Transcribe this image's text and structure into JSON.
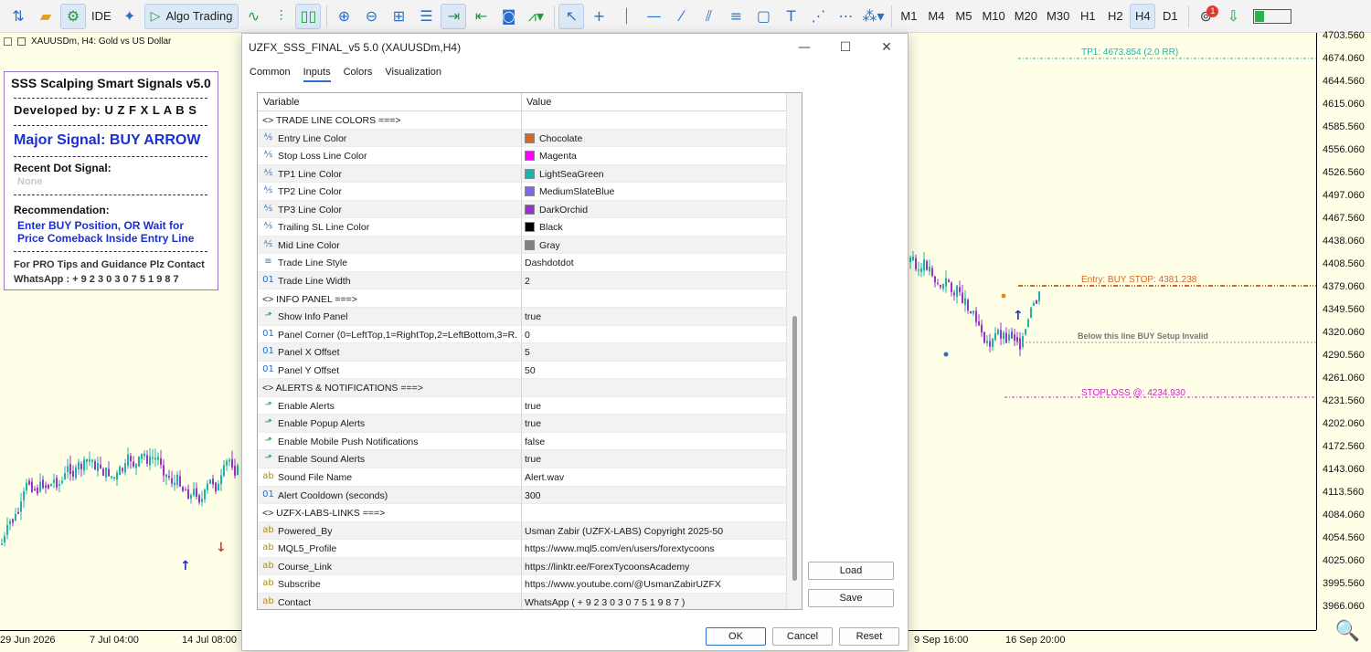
{
  "toolbar": {
    "ide_label": "IDE",
    "algo_label": "Algo Trading",
    "timeframes": [
      "M1",
      "M4",
      "M5",
      "M10",
      "M20",
      "M30",
      "H1",
      "H2",
      "H4",
      "D1"
    ],
    "active_timeframe": "H4",
    "notification_count": "1"
  },
  "chart": {
    "symbol_line": "XAUUSDm, H4:  Gold vs US Dollar",
    "price_labels": [
      "4703.560",
      "4674.060",
      "4644.560",
      "4615.060",
      "4585.560",
      "4556.060",
      "4526.560",
      "4497.060",
      "4467.560",
      "4438.060",
      "4408.560",
      "4379.060",
      "4349.560",
      "4320.060",
      "4290.560",
      "4261.060",
      "4231.560",
      "4202.060",
      "4172.560",
      "4143.060",
      "4113.560",
      "4084.060",
      "4054.560",
      "4025.060",
      "3995.560",
      "3966.060"
    ],
    "time_labels": [
      "29 Jun 2026",
      "7 Jul 04:00",
      "14 Jul 08:00",
      "9 Sep 16:00",
      "16 Sep 20:00"
    ],
    "annotations": {
      "tp1": "TP1: 4673.854 (2.0 RR)",
      "entry": "Entry: BUY STOP: 4381.238",
      "invalid": "Below this line BUY Setup Invalid",
      "stoploss": "STOPLOSS @: 4234.930"
    },
    "colors": {
      "background": "#ffffe8",
      "tp": "#20b2aa",
      "entry": "#d2691e",
      "stoploss": "#cc22cc",
      "bull": "#20b2aa",
      "bear": "#9932cc"
    }
  },
  "info_panel": {
    "title": "SSS Scalping Smart Signals v5.0",
    "developed": "Developed by:  U Z F X    L A B S",
    "major_signal": "Major Signal: BUY ARROW",
    "recent_label": "Recent Dot Signal:",
    "recent_value": "None",
    "recommendation_label": "Recommendation:",
    "recommendation_line1": "Enter BUY Position, OR Wait for",
    "recommendation_line2": "Price Comeback Inside Entry Line",
    "pro_tips": "For PRO Tips and Guidance Plz Contact",
    "whatsapp": "WhatsApp :  + 9 2 3 0 3 0 7 5 1 9 8 7"
  },
  "dialog": {
    "title": "UZFX_SSS_FINAL_v5 5.0 (XAUUSDm,H4)",
    "tabs": [
      "Common",
      "Inputs",
      "Colors",
      "Visualization"
    ],
    "active_tab": "Inputs",
    "col_variable": "Variable",
    "col_value": "Value",
    "rows": [
      {
        "kind": "section",
        "name": "<> TRADE LINE COLORS ===>",
        "value": ""
      },
      {
        "kind": "color",
        "name": "Entry Line Color",
        "value": "Chocolate",
        "swatch": "#d2691e"
      },
      {
        "kind": "color",
        "name": "Stop Loss Line Color",
        "value": "Magenta",
        "swatch": "#ff00ff"
      },
      {
        "kind": "color",
        "name": "TP1 Line Color",
        "value": "LightSeaGreen",
        "swatch": "#20b2aa"
      },
      {
        "kind": "color",
        "name": "TP2 Line Color",
        "value": "MediumSlateBlue",
        "swatch": "#7b68ee"
      },
      {
        "kind": "color",
        "name": "TP3 Line Color",
        "value": "DarkOrchid",
        "swatch": "#9932cc"
      },
      {
        "kind": "color",
        "name": "Trailing SL Line Color",
        "value": "Black",
        "swatch": "#000000"
      },
      {
        "kind": "color",
        "name": "Mid Line Color",
        "value": "Gray",
        "swatch": "#808080"
      },
      {
        "kind": "style",
        "name": "Trade Line Style",
        "value": "Dashdotdot"
      },
      {
        "kind": "int",
        "name": "Trade Line Width",
        "value": "2"
      },
      {
        "kind": "section",
        "name": "<> INFO PANEL ===>",
        "value": ""
      },
      {
        "kind": "bool",
        "name": "Show Info Panel",
        "value": "true"
      },
      {
        "kind": "int",
        "name": "Panel Corner (0=LeftTop,1=RightTop,2=LeftBottom,3=R...",
        "value": "0"
      },
      {
        "kind": "int",
        "name": "Panel X Offset",
        "value": "5"
      },
      {
        "kind": "int",
        "name": "Panel Y Offset",
        "value": "50"
      },
      {
        "kind": "section",
        "name": "<>  ALERTS & NOTIFICATIONS ===>",
        "value": ""
      },
      {
        "kind": "bool",
        "name": "Enable Alerts",
        "value": "true"
      },
      {
        "kind": "bool",
        "name": "Enable Popup Alerts",
        "value": "true"
      },
      {
        "kind": "bool",
        "name": "Enable Mobile Push Notifications",
        "value": "false"
      },
      {
        "kind": "bool",
        "name": "Enable Sound Alerts",
        "value": "true"
      },
      {
        "kind": "str",
        "name": "Sound File Name",
        "value": "Alert.wav"
      },
      {
        "kind": "int",
        "name": "Alert Cooldown (seconds)",
        "value": "300"
      },
      {
        "kind": "section",
        "name": "<> UZFX-LABS-LINKS ===>",
        "value": ""
      },
      {
        "kind": "str",
        "name": "Powered_By",
        "value": "Usman Zabir (UZFX-LABS) Copyright 2025-50"
      },
      {
        "kind": "str",
        "name": "MQL5_Profile",
        "value": "https://www.mql5.com/en/users/forextycoons"
      },
      {
        "kind": "str",
        "name": "Course_Link",
        "value": "https://linktr.ee/ForexTycoonsAcademy"
      },
      {
        "kind": "str",
        "name": "Subscribe",
        "value": "https://www.youtube.com/@UsmanZabirUZFX"
      },
      {
        "kind": "str",
        "name": "Contact",
        "value": " WhatsApp ( + 9 2 3 0 3 0 7 5 1 9 8 7 )"
      }
    ],
    "buttons": {
      "load": "Load",
      "save": "Save",
      "ok": "OK",
      "cancel": "Cancel",
      "reset": "Reset"
    }
  }
}
